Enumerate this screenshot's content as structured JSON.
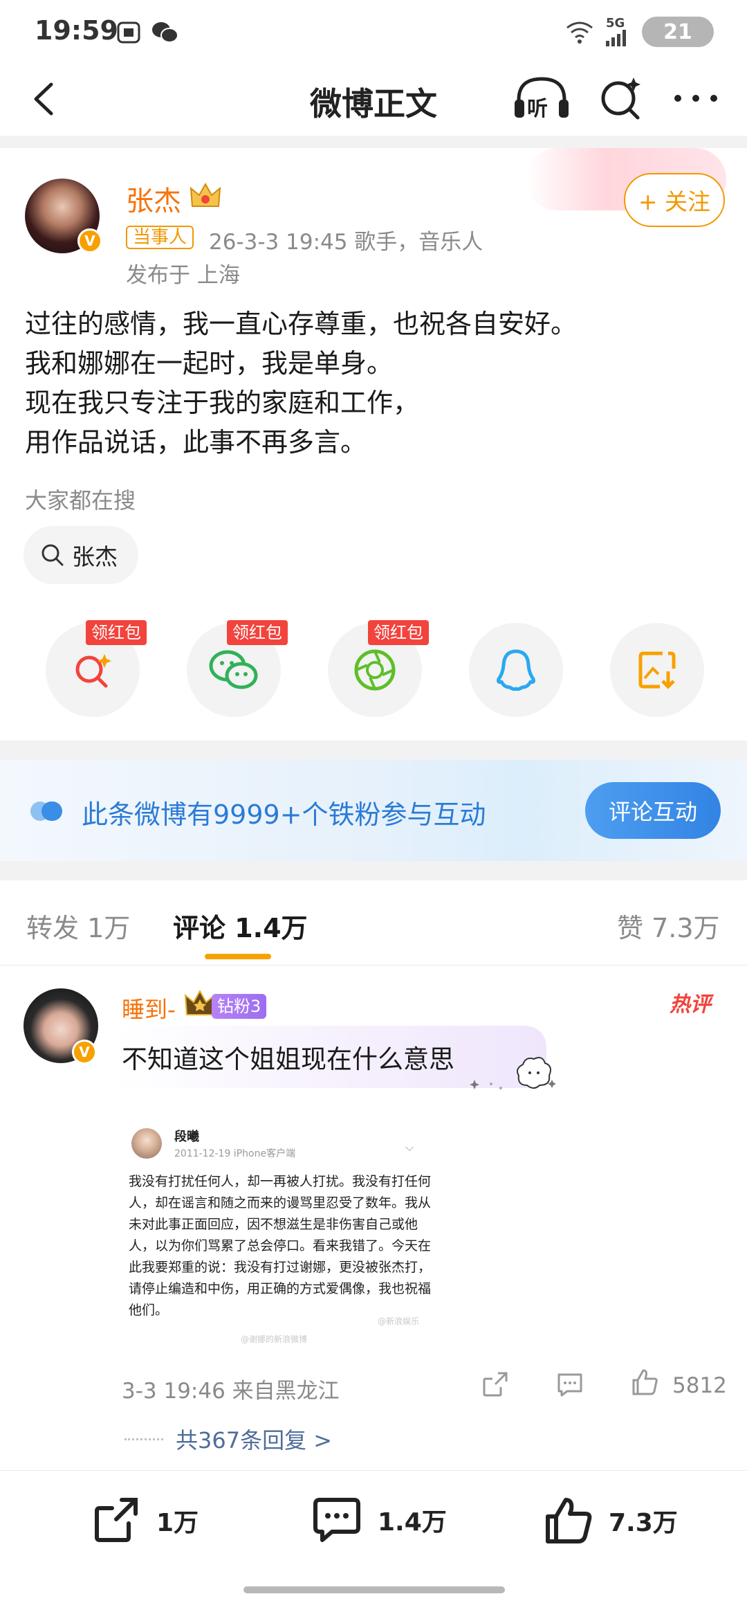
{
  "status_bar": {
    "time": "19:59",
    "network": "5G",
    "battery": "21",
    "icons": [
      "screenshot-icon",
      "wechat-icon",
      "wifi-icon",
      "signal-icon",
      "battery-icon"
    ]
  },
  "nav": {
    "title": "微博正文",
    "listen_label": "听"
  },
  "post": {
    "author": "张杰",
    "tag": "当事人",
    "meta": "26-3-3 19:45   歌手，音乐人",
    "location": "发布于 上海",
    "follow_label": "+ 关注",
    "lines": [
      "过往的感情，我一直心存尊重，也祝各自安好。",
      "我和娜娜在一起时，我是单身。",
      "现在我只专注于我的家庭和工作，",
      "用作品说话，此事不再多言。"
    ],
    "search_label": "大家都在搜",
    "search_chip": "张杰"
  },
  "share": {
    "red_packet_label": "领红包",
    "items": [
      "weibo-share-icon",
      "wechat-share-icon",
      "moments-share-icon",
      "qq-share-icon",
      "save-image-icon"
    ]
  },
  "iron_fans": {
    "text": "此条微博有9999+个铁粉参与互动",
    "button": "评论互动"
  },
  "tabs": {
    "repost": "转发 1万",
    "comments": "评论 1.4万",
    "likes": "赞 7.3万"
  },
  "comment": {
    "user": "睡到-",
    "fan_badge": "钻粉3",
    "hot_label": "热评",
    "text": "不知道这个姐姐现在什么意思",
    "quote": {
      "name": "段曦",
      "date": "2011-12-19  iPhone客户端",
      "text": "我没有打扰任何人，却一再被人打扰。我没有打任何人，却在谣言和随之而来的谩骂里忍受了数年。我从未对此事正面回应，因不想滋生是非伤害自己或他人，以为你们骂累了总会停口。看来我错了。今天在此我要郑重的说：我没有打过谢娜，更没被张杰打，请停止编造和中伤，用正确的方式爱偶像，我也祝福他们。",
      "watermark_left": "@谢娜的新浪微博",
      "watermark_right": "@新浪娱乐"
    },
    "time": "3-3 19:46  来自黑龙江",
    "likes": "5812",
    "replies": "共367条回复 >"
  },
  "bottom_bar": {
    "repost": "1万",
    "comment": "1.4万",
    "like": "7.3万"
  },
  "colors": {
    "orange": "#f7730c",
    "accent": "#f39800",
    "blue": "#2b7bd6",
    "red_tag": "#f2433d"
  }
}
